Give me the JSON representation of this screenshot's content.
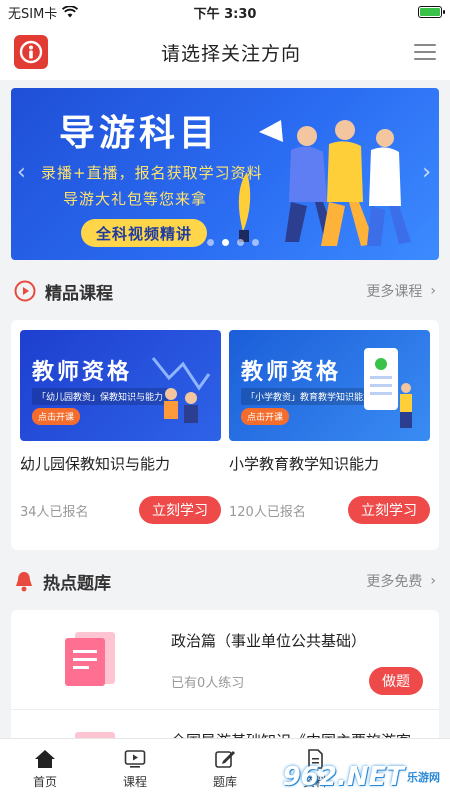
{
  "status_bar": {
    "carrier": "无SIM卡",
    "time": "下午 3:30"
  },
  "nav": {
    "title": "请选择关注方向"
  },
  "banner": {
    "title": "导游科目",
    "line1": "录播+直播，报名获取学习资料",
    "line2": "导游大礼包等您来拿",
    "cta": "全科视频精讲",
    "slide_count": 4,
    "active_slide": 1
  },
  "courses_section": {
    "title": "精品课程",
    "more": "更多课程",
    "items": [
      {
        "thumb_title": "教师资格",
        "thumb_sub": "「幼儿园教资」保教知识与能力",
        "thumb_tag": "点击开课",
        "name": "幼儿园保教知识与能力",
        "enrolled": "34人已报名",
        "button": "立刻学习"
      },
      {
        "thumb_title": "教师资格",
        "thumb_sub": "「小学教资」教育教学知识能力",
        "thumb_tag": "点击开课",
        "name": "小学教育教学知识能力",
        "enrolled": "120人已报名",
        "button": "立刻学习"
      }
    ]
  },
  "quiz_section": {
    "title": "热点题库",
    "more": "更多免费",
    "items": [
      {
        "title": "政治篇（事业单位公共基础）",
        "count": "已有0人练习",
        "button": "做题"
      },
      {
        "title": "全国导游基础知识《中国主要旅游客",
        "count": "",
        "button": ""
      }
    ]
  },
  "tabs": [
    {
      "label": "首页",
      "icon": "home-icon"
    },
    {
      "label": "课程",
      "icon": "video-icon"
    },
    {
      "label": "题库",
      "icon": "edit-icon"
    },
    {
      "label": "资料",
      "icon": "document-icon"
    }
  ],
  "watermark": {
    "text": "962.NET",
    "sub": "乐游网"
  },
  "colors": {
    "accent": "#ef4a4a",
    "banner_blue": "#2a6cf2",
    "cta_yellow": "#ffd54a"
  }
}
